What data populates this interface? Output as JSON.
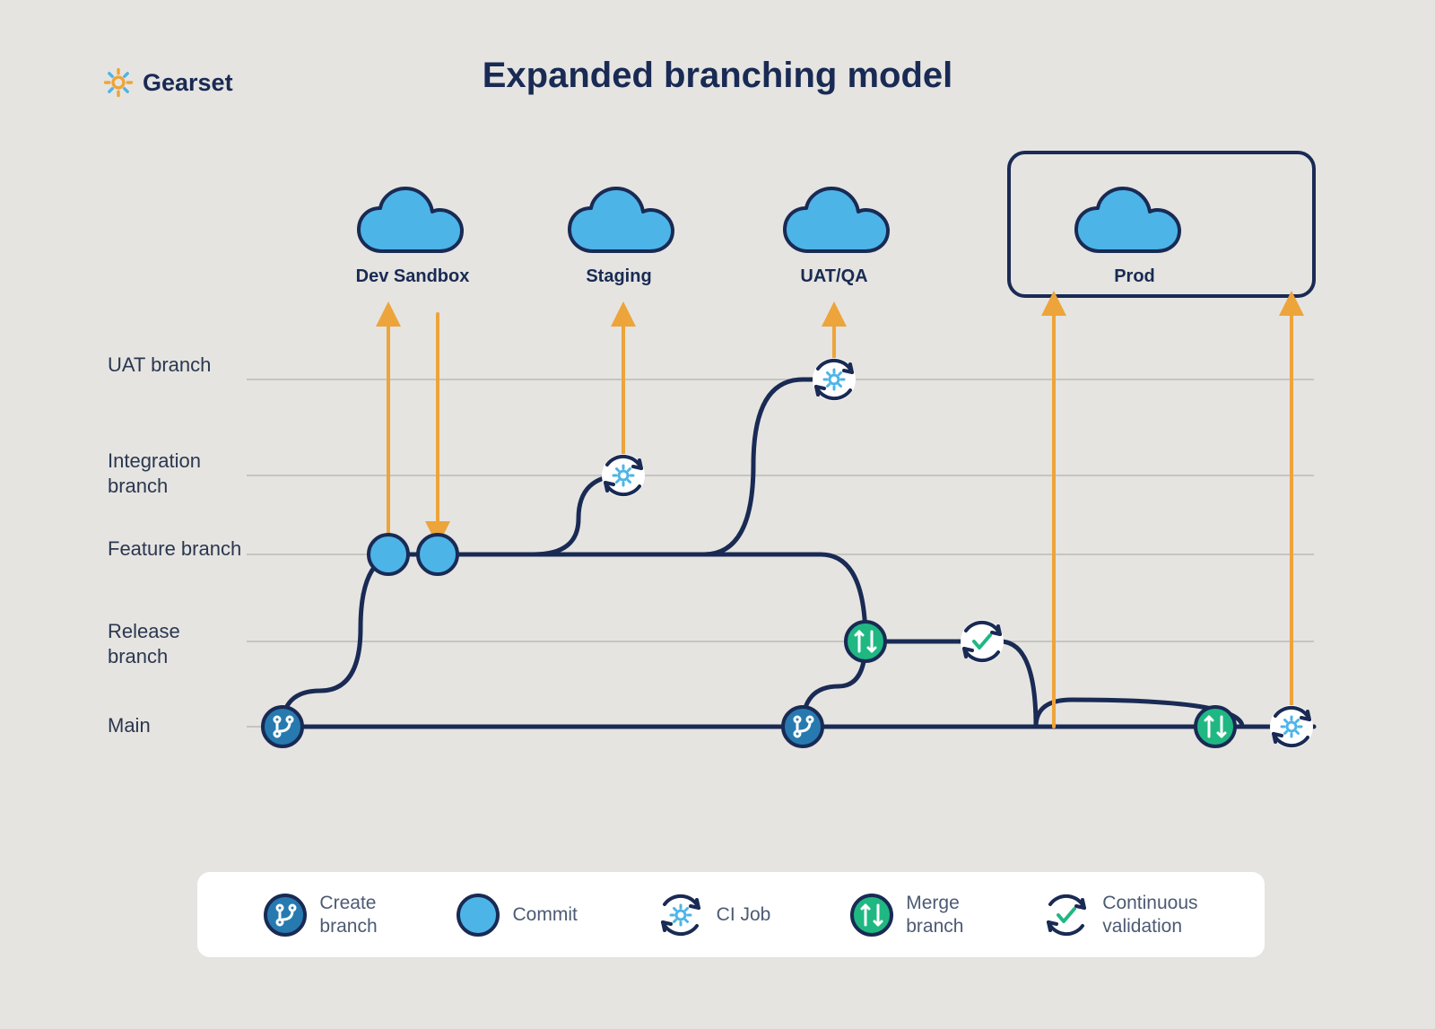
{
  "brand": "Gearset",
  "title": "Expanded branching model",
  "environments": {
    "dev": "Dev Sandbox",
    "staging": "Staging",
    "uat": "UAT/QA",
    "prod": "Prod"
  },
  "branches": {
    "uat": "UAT branch",
    "integration": "Integration branch",
    "feature": "Feature branch",
    "release": "Release branch",
    "main": "Main"
  },
  "legend": {
    "create": "Create\nbranch",
    "commit": "Commit",
    "ci": "CI Job",
    "merge": "Merge\nbranch",
    "cv": "Continuous\nvalidation"
  }
}
